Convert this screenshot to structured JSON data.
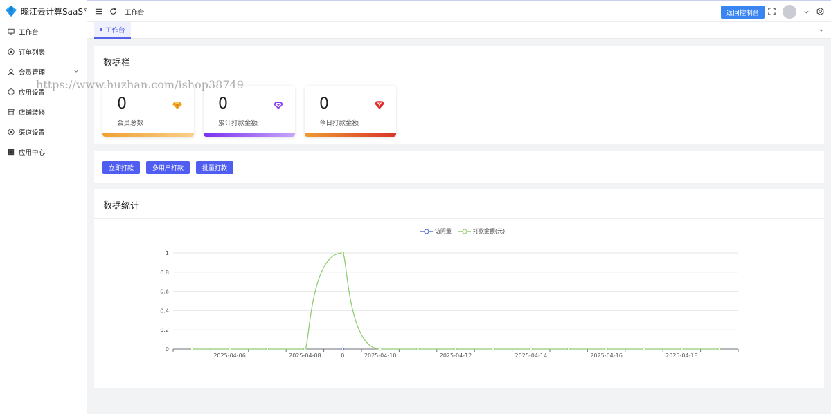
{
  "app": {
    "title": "晓江云计算SaaS平台"
  },
  "sidebar": {
    "items": [
      {
        "label": "工作台",
        "icon": "monitor-icon"
      },
      {
        "label": "订单列表",
        "icon": "compass-icon"
      },
      {
        "label": "会员管理",
        "icon": "user-icon",
        "has_submenu": true
      },
      {
        "label": "应用设置",
        "icon": "gear-icon"
      },
      {
        "label": "店铺装修",
        "icon": "shop-icon"
      },
      {
        "label": "渠道设置",
        "icon": "compass-icon"
      },
      {
        "label": "应用中心",
        "icon": "grid-icon"
      }
    ]
  },
  "header": {
    "breadcrumb": "工作台",
    "console_button": "返回控制台"
  },
  "tabs": [
    {
      "label": "工作台",
      "active": true
    }
  ],
  "data_panel": {
    "title": "数据栏",
    "stats": [
      {
        "value": "0",
        "label": "会员总数",
        "icon": "diamond-icon",
        "color": "#f0a020",
        "bar_color": "#f5b95a"
      },
      {
        "value": "0",
        "label": "累计打款金额",
        "icon": "gem-icon",
        "color": "#8a3ff0",
        "bar_color": "#9b5cf5"
      },
      {
        "value": "0",
        "label": "今日打款金额",
        "icon": "ruby-icon",
        "color": "#e02a2a",
        "bar_color": "#e8553a"
      }
    ]
  },
  "actions": [
    "立即打款",
    "多用户打款",
    "批量打款"
  ],
  "stats_panel": {
    "title": "数据统计"
  },
  "watermark": "https://www.huzhan.com/ishop38749",
  "colors": {
    "primary": "#4f5ef0",
    "console": "#3a85f2",
    "series_visits": "#5470c6",
    "series_amount": "#91cc75"
  },
  "chart_data": {
    "type": "line",
    "legend": [
      "访问量",
      "打款金额(元)"
    ],
    "legend_position": "top-center",
    "x": [
      "2025-04-05",
      "2025-04-06",
      "2025-04-07",
      "2025-04-08",
      "2025-04-09",
      "2025-04-10",
      "2025-04-11",
      "2025-04-12",
      "2025-04-13",
      "2025-04-14",
      "2025-04-15",
      "2025-04-16",
      "2025-04-17",
      "2025-04-18",
      "2025-04-19"
    ],
    "x_tick_labels": [
      "2025-04-06",
      "2025-04-08",
      "2025-04-10",
      "2025-04-12",
      "2025-04-14",
      "2025-04-16",
      "2025-04-18"
    ],
    "series": [
      {
        "name": "访问量",
        "x": [
          "2025-04-09"
        ],
        "values": [
          0
        ],
        "color": "#5470c6"
      },
      {
        "name": "打款金额(元)",
        "x": [
          "2025-04-05",
          "2025-04-06",
          "2025-04-07",
          "2025-04-08",
          "2025-04-09",
          "2025-04-10",
          "2025-04-11",
          "2025-04-12",
          "2025-04-13",
          "2025-04-14",
          "2025-04-15",
          "2025-04-16",
          "2025-04-17",
          "2025-04-18",
          "2025-04-19"
        ],
        "values": [
          0,
          0,
          0,
          0,
          1,
          0,
          0,
          0,
          0,
          0,
          0,
          0,
          0,
          0,
          0
        ],
        "color": "#91cc75"
      }
    ],
    "y_ticks": [
      "0",
      "0.2",
      "0.4",
      "0.6",
      "0.8",
      "1"
    ],
    "ylim": [
      0,
      1
    ],
    "extra_x_label": "0",
    "grid": true
  }
}
